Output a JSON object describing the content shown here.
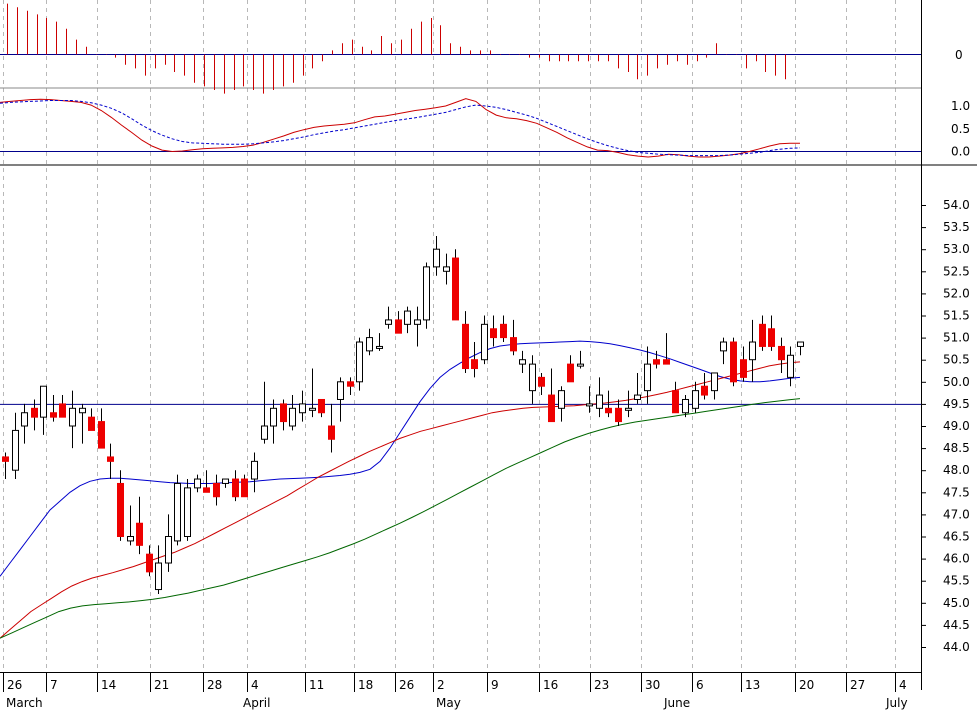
{
  "chart_data": [
    {
      "type": "bar",
      "panel": "momentum-histogram",
      "title": "",
      "xlabel": "",
      "ylabel": "",
      "yticks": [
        "0"
      ],
      "ylim": [
        -1.2,
        1.8
      ],
      "colors": {
        "bar": "#cc0000",
        "zero": "#00008b"
      },
      "values": [
        1.4,
        1.3,
        1.2,
        1.1,
        1.0,
        0.9,
        0.7,
        0.4,
        0.2,
        0,
        0,
        -0.1,
        -0.3,
        -0.4,
        -0.6,
        -0.4,
        -0.3,
        -0.5,
        -0.6,
        -0.8,
        -0.9,
        -1.0,
        -1.1,
        -1.0,
        -0.9,
        -1.0,
        -1.1,
        -1.0,
        -0.9,
        -0.8,
        -0.6,
        -0.4,
        -0.2,
        0.1,
        0.3,
        0.4,
        0.2,
        0.1,
        0.5,
        0.3,
        0.4,
        0.7,
        0.9,
        1.0,
        0.8,
        0.3,
        0.2,
        0.1,
        0.1,
        0.1,
        0,
        0,
        0,
        -0.1,
        -0.1,
        -0.2,
        -0.2,
        -0.2,
        -0.2,
        -0.2,
        -0.2,
        -0.2,
        -0.4,
        -0.5,
        -0.7,
        -0.6,
        -0.4,
        -0.3,
        -0.2,
        -0.3,
        -0.2,
        -0.1,
        0.3,
        0,
        0,
        -0.4,
        -0.2,
        -0.5,
        -0.6,
        -0.7
      ]
    },
    {
      "type": "line",
      "panel": "oscillator",
      "title": "",
      "yticks": [
        "1.0",
        "0.5",
        "0.0"
      ],
      "ylim": [
        -0.35,
        1.3
      ],
      "series": [
        {
          "style": "solid",
          "color": "#cc0000",
          "values": [
            1.08,
            1.1,
            1.12,
            1.14,
            1.15,
            1.14,
            1.12,
            1.1,
            1.08,
            1.02,
            0.9,
            0.75,
            0.58,
            0.42,
            0.25,
            0.12,
            0.03,
            0,
            0.01,
            0.04,
            0.06,
            0.07,
            0.08,
            0.09,
            0.11,
            0.14,
            0.2,
            0.27,
            0.34,
            0.42,
            0.48,
            0.53,
            0.56,
            0.58,
            0.6,
            0.63,
            0.7,
            0.76,
            0.78,
            0.82,
            0.86,
            0.9,
            0.93,
            0.96,
            1.0,
            1.08,
            1.16,
            1.1,
            0.92,
            0.8,
            0.74,
            0.72,
            0.68,
            0.62,
            0.52,
            0.42,
            0.3,
            0.2,
            0.1,
            0.03,
            0.02,
            -0.02,
            -0.07,
            -0.1,
            -0.12,
            -0.1,
            -0.06,
            -0.07,
            -0.1,
            -0.12,
            -0.12,
            -0.1,
            -0.08,
            -0.05,
            0,
            0.06,
            0.12,
            0.17,
            0.18,
            0.18
          ]
        },
        {
          "style": "dashed",
          "color": "#0000cc",
          "values": [
            1.06,
            1.08,
            1.09,
            1.1,
            1.11,
            1.12,
            1.12,
            1.12,
            1.1,
            1.07,
            1.02,
            0.95,
            0.85,
            0.72,
            0.58,
            0.46,
            0.36,
            0.28,
            0.22,
            0.19,
            0.18,
            0.17,
            0.16,
            0.16,
            0.16,
            0.17,
            0.19,
            0.21,
            0.24,
            0.28,
            0.32,
            0.37,
            0.41,
            0.45,
            0.48,
            0.52,
            0.56,
            0.6,
            0.64,
            0.68,
            0.71,
            0.74,
            0.78,
            0.82,
            0.86,
            0.92,
            0.98,
            1.02,
            1.0,
            0.97,
            0.92,
            0.86,
            0.8,
            0.73,
            0.64,
            0.55,
            0.46,
            0.37,
            0.28,
            0.2,
            0.13,
            0.07,
            0.02,
            -0.02,
            -0.04,
            -0.06,
            -0.07,
            -0.08,
            -0.09,
            -0.09,
            -0.09,
            -0.09,
            -0.08,
            -0.06,
            -0.04,
            -0.02,
            0.02,
            0.05,
            0.07,
            0.08
          ]
        }
      ]
    },
    {
      "type": "candlestick",
      "panel": "price",
      "title": "",
      "xlabel": "",
      "ylabel": "",
      "ylim": [
        43.4,
        54.2
      ],
      "yticks": [
        "54.0",
        "53.5",
        "53.0",
        "52.5",
        "52.0",
        "51.5",
        "51.0",
        "50.5",
        "50.0",
        "49.5",
        "49.0",
        "48.5",
        "48.0",
        "47.5",
        "47.0",
        "46.5",
        "46.0",
        "45.5",
        "45.0",
        "44.5",
        "44.0"
      ],
      "xticks": [
        "26",
        "7",
        "14",
        "21",
        "28",
        "4",
        "11",
        "18",
        "26",
        "2",
        "9",
        "16",
        "23",
        "30",
        "6",
        "13",
        "20",
        "27",
        "4"
      ],
      "months": [
        "March",
        "April",
        "May",
        "June",
        "July"
      ],
      "grid": "vertical-dashed",
      "reference_line": 49.5,
      "colors": {
        "up": "#ffffff",
        "down": "#ee0000",
        "ma_fast": "#0000cc",
        "ma_mid": "#cc0000",
        "ma_slow": "#006600",
        "ref": "#00008b"
      },
      "ohlc": [
        [
          48.3,
          48.4,
          47.8,
          48.2
        ],
        [
          48.0,
          49.3,
          47.8,
          48.9
        ],
        [
          49.0,
          49.5,
          48.6,
          49.3
        ],
        [
          49.4,
          49.6,
          48.9,
          49.2
        ],
        [
          49.2,
          49.9,
          48.8,
          49.9
        ],
        [
          49.3,
          49.7,
          49.1,
          49.2
        ],
        [
          49.5,
          49.7,
          49.2,
          49.2
        ],
        [
          49.0,
          49.8,
          48.5,
          49.4
        ],
        [
          49.3,
          49.5,
          48.6,
          49.4
        ],
        [
          49.2,
          49.4,
          49.0,
          48.9
        ],
        [
          49.1,
          49.4,
          48.5,
          48.5
        ],
        [
          48.3,
          48.6,
          47.8,
          48.2
        ],
        [
          47.7,
          48.0,
          46.4,
          46.5
        ],
        [
          46.4,
          47.2,
          46.3,
          46.5
        ],
        [
          46.8,
          47.4,
          46.1,
          46.3
        ],
        [
          46.1,
          46.3,
          45.6,
          45.7
        ],
        [
          45.3,
          46.3,
          45.2,
          45.9
        ],
        [
          45.9,
          47.0,
          45.7,
          46.5
        ],
        [
          46.4,
          47.9,
          46.3,
          47.7
        ],
        [
          46.5,
          47.8,
          46.4,
          47.6
        ],
        [
          47.6,
          47.9,
          47.5,
          47.8
        ],
        [
          47.6,
          48.0,
          47.5,
          47.5
        ],
        [
          47.7,
          47.9,
          47.2,
          47.4
        ],
        [
          47.7,
          47.8,
          47.6,
          47.8
        ],
        [
          47.8,
          48.0,
          47.3,
          47.4
        ],
        [
          47.8,
          47.9,
          47.4,
          47.4
        ],
        [
          47.8,
          48.4,
          47.5,
          48.2
        ],
        [
          48.7,
          50.0,
          48.6,
          49.0
        ],
        [
          49.0,
          49.6,
          48.6,
          49.4
        ],
        [
          49.5,
          49.6,
          48.9,
          49.1
        ],
        [
          49.0,
          49.7,
          48.9,
          49.4
        ],
        [
          49.3,
          49.8,
          49.1,
          49.5
        ],
        [
          49.4,
          50.3,
          49.2,
          49.4
        ],
        [
          49.6,
          49.6,
          49.2,
          49.3
        ],
        [
          49.0,
          49.5,
          48.4,
          48.7
        ],
        [
          49.6,
          50.1,
          49.1,
          50.0
        ],
        [
          50.0,
          50.1,
          49.7,
          49.9
        ],
        [
          50.0,
          51.0,
          49.8,
          50.9
        ],
        [
          50.7,
          51.2,
          50.6,
          51.0
        ],
        [
          50.8,
          51.1,
          50.7,
          50.8
        ],
        [
          51.3,
          51.7,
          51.2,
          51.4
        ],
        [
          51.4,
          51.6,
          51.2,
          51.1
        ],
        [
          51.3,
          51.7,
          51.1,
          51.6
        ],
        [
          51.3,
          51.7,
          50.8,
          51.4
        ],
        [
          51.4,
          52.7,
          51.2,
          52.6
        ],
        [
          52.6,
          53.3,
          52.4,
          53.0
        ],
        [
          52.5,
          52.9,
          52.2,
          52.6
        ],
        [
          52.8,
          53.0,
          51.4,
          51.4
        ],
        [
          51.3,
          51.6,
          50.2,
          50.3
        ],
        [
          50.5,
          50.9,
          50.1,
          50.3
        ],
        [
          50.5,
          51.5,
          50.4,
          51.3
        ],
        [
          51.2,
          51.5,
          50.8,
          51.0
        ],
        [
          51.3,
          51.5,
          50.9,
          51.0
        ],
        [
          51.0,
          51.4,
          50.6,
          50.7
        ],
        [
          50.4,
          50.7,
          50.2,
          50.5
        ],
        [
          49.8,
          50.6,
          49.5,
          50.4
        ],
        [
          50.1,
          50.2,
          49.7,
          49.9
        ],
        [
          49.7,
          50.3,
          49.2,
          49.1
        ],
        [
          49.4,
          49.9,
          49.1,
          49.8
        ],
        [
          50.4,
          50.6,
          50.1,
          50.0
        ],
        [
          50.4,
          50.7,
          50.3,
          50.4
        ],
        [
          49.5,
          49.9,
          49.3,
          49.5
        ],
        [
          49.4,
          50.1,
          49.2,
          49.7
        ],
        [
          49.4,
          49.8,
          49.2,
          49.3
        ],
        [
          49.4,
          49.6,
          49.0,
          49.1
        ],
        [
          49.4,
          49.8,
          49.2,
          49.4
        ],
        [
          49.6,
          50.2,
          49.5,
          49.7
        ],
        [
          49.8,
          50.8,
          49.5,
          50.4
        ],
        [
          50.5,
          50.7,
          50.3,
          50.4
        ],
        [
          50.5,
          51.1,
          50.4,
          50.4
        ],
        [
          49.8,
          50.0,
          49.3,
          49.3
        ],
        [
          49.3,
          49.7,
          49.2,
          49.6
        ],
        [
          49.4,
          50.0,
          49.3,
          49.8
        ],
        [
          49.9,
          50.2,
          49.6,
          49.7
        ],
        [
          49.8,
          50.2,
          49.6,
          50.2
        ],
        [
          50.7,
          51.0,
          50.4,
          50.9
        ],
        [
          50.9,
          51.0,
          49.9,
          50.0
        ],
        [
          50.5,
          50.8,
          50.0,
          50.1
        ],
        [
          50.5,
          51.4,
          50.0,
          50.9
        ],
        [
          51.3,
          51.5,
          50.7,
          50.8
        ],
        [
          51.2,
          51.5,
          50.7,
          50.8
        ],
        [
          50.8,
          51.0,
          50.2,
          50.5
        ],
        [
          50.1,
          50.8,
          49.9,
          50.6
        ],
        [
          50.8,
          50.9,
          50.6,
          50.9
        ]
      ],
      "series": [
        {
          "color": "#0000cc",
          "values": [
            45.6,
            45.9,
            46.2,
            46.5,
            46.8,
            47.1,
            47.3,
            47.5,
            47.65,
            47.75,
            47.8,
            47.82,
            47.82,
            47.8,
            47.78,
            47.76,
            47.74,
            47.72,
            47.71,
            47.7,
            47.7,
            47.7,
            47.71,
            47.72,
            47.73,
            47.74,
            47.76,
            47.78,
            47.8,
            47.81,
            47.82,
            47.83,
            47.84,
            47.86,
            47.88,
            47.91,
            47.95,
            48.02,
            48.2,
            48.5,
            48.85,
            49.2,
            49.55,
            49.85,
            50.1,
            50.28,
            50.42,
            50.55,
            50.66,
            50.75,
            50.81,
            50.84,
            50.86,
            50.87,
            50.88,
            50.89,
            50.9,
            50.91,
            50.92,
            50.91,
            50.89,
            50.86,
            50.82,
            50.77,
            50.72,
            50.66,
            50.59,
            50.52,
            50.44,
            50.36,
            50.28,
            50.2,
            50.12,
            50.06,
            50.02,
            50.0,
            50.0,
            50.02,
            50.05,
            50.08,
            50.1
          ]
        },
        {
          "color": "#cc0000",
          "values": [
            44.2,
            44.4,
            44.6,
            44.8,
            44.95,
            45.1,
            45.25,
            45.38,
            45.48,
            45.56,
            45.62,
            45.68,
            45.75,
            45.82,
            45.9,
            45.98,
            46.06,
            46.14,
            46.24,
            46.34,
            46.46,
            46.58,
            46.7,
            46.82,
            46.94,
            47.06,
            47.18,
            47.3,
            47.42,
            47.56,
            47.7,
            47.84,
            47.96,
            48.08,
            48.2,
            48.31,
            48.42,
            48.52,
            48.62,
            48.72,
            48.8,
            48.88,
            48.94,
            49.0,
            49.06,
            49.12,
            49.18,
            49.24,
            49.3,
            49.34,
            49.37,
            49.4,
            49.42,
            49.43,
            49.44,
            49.45,
            49.46,
            49.48,
            49.5,
            49.52,
            49.55,
            49.58,
            49.62,
            49.66,
            49.71,
            49.76,
            49.82,
            49.88,
            49.94,
            50.0,
            50.06,
            50.12,
            50.18,
            50.24,
            50.3,
            50.36,
            50.4,
            50.43,
            50.45
          ]
        },
        {
          "color": "#006600",
          "values": [
            44.2,
            44.32,
            44.44,
            44.56,
            44.68,
            44.8,
            44.88,
            44.93,
            44.96,
            44.98,
            45.0,
            45.02,
            45.05,
            45.08,
            45.12,
            45.17,
            45.22,
            45.28,
            45.34,
            45.4,
            45.48,
            45.56,
            45.64,
            45.72,
            45.8,
            45.88,
            45.96,
            46.04,
            46.13,
            46.23,
            46.33,
            46.44,
            46.56,
            46.68,
            46.8,
            46.93,
            47.06,
            47.2,
            47.34,
            47.48,
            47.62,
            47.76,
            47.9,
            48.04,
            48.16,
            48.28,
            48.4,
            48.52,
            48.64,
            48.74,
            48.83,
            48.91,
            48.98,
            49.04,
            49.09,
            49.13,
            49.17,
            49.21,
            49.25,
            49.29,
            49.33,
            49.37,
            49.41,
            49.45,
            49.49,
            49.53,
            49.56,
            49.59,
            49.62
          ]
        }
      ]
    }
  ]
}
